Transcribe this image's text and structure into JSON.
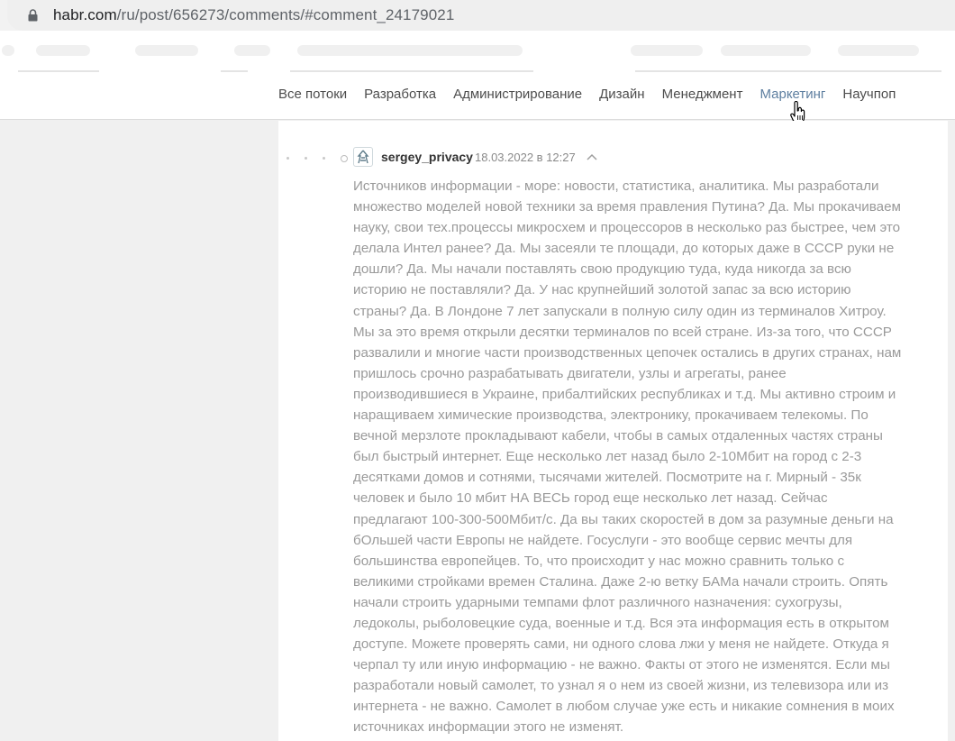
{
  "browser": {
    "url_host": "habr.com",
    "url_path": "/ru/post/656273/comments/#comment_24179021",
    "lock_icon": "lock-icon"
  },
  "nav": {
    "items": [
      "Все потоки",
      "Разработка",
      "Администрирование",
      "Дизайн",
      "Менеджмент",
      "Маркетинг",
      "Научпоп"
    ],
    "active_index": 5,
    "cursor_icon": "hand-pointer-icon"
  },
  "comment": {
    "author": "sergey_privacy",
    "date": "18.03.2022 в 12:27",
    "lines": [
      "Источников информации - море: новости, статистика, аналитика. Мы разработали",
      "множество моделей новой техники за время правления Путина? Да. Мы прокачиваем",
      "науку, свои тех.процессы микросхем и процессоров в несколько раз быстрее, чем это",
      "делала Интел ранее? Да. Мы засеяли те площади, до которых даже в СССР руки не",
      "дошли? Да. Мы начали поставлять свою продукцию туда, куда никогда за всю",
      "историю не поставляли? Да. У нас крупнейший золотой запас за всю историю",
      "страны? Да. В Лондоне 7 лет запускали в полную силу один из терминалов Хитроу.",
      "Мы за это время открыли десятки терминалов по всей стране. Из-за того, что СССР",
      "развалили и многие части производственных цепочек остались в других странах, нам",
      "пришлось срочно разрабатывать двигатели, узлы и агрегаты, ранее",
      "производившиеся в Украине, прибалтийских республиках и т.д. Мы активно строим и",
      "наращиваем химические производства, электронику, прокачиваем телекомы. По",
      "вечной мерзлоте прокладывают кабели, чтобы в самых отдаленных частях страны",
      "был быстрый интернет. Еще несколько лет назад было 2-10Мбит на город с 2-3",
      "десятками домов и сотнями, тысячами жителей. Посмотрите на г. Мирный - 35к",
      "человек и было 10 мбит НА ВЕСЬ город еще несколько лет назад. Сейчас",
      "предлагают 100-300-500Мбит/с. Да вы таких скоростей в дом за разумные деньги на",
      "бОльшей части Европы не найдете. Госуслуги - это вообще сервис мечты для",
      "большинства европейцев. То, что происходит у нас можно сравнить только с",
      "великими стройками времен Сталина. Даже 2-ю ветку БАМа начали строить. Опять",
      "начали строить ударными темпами флот различного назначения: сухогрузы,",
      "ледоколы, рыболовецкие суда, военные и т.д. Вся эта информация есть в открытом",
      "доступе. Можете проверять сами, ни одного слова лжи у меня не найдете. Откуда я",
      "черпал ту или иную информацию - не важно. Факты от этого не изменятся. Если мы",
      "разработали новый самолет, то узнал я о нем из своей жизни, из телевизора или из",
      "интернета - не важно. Самолет в любом случае уже есть и никакие сомнения в моих",
      "источниках информации этого не изменят."
    ]
  },
  "colors": {
    "nav_active": "#5e7fa0",
    "comment_text": "#9a9a9a",
    "page_bg": "#f0f0f0"
  }
}
